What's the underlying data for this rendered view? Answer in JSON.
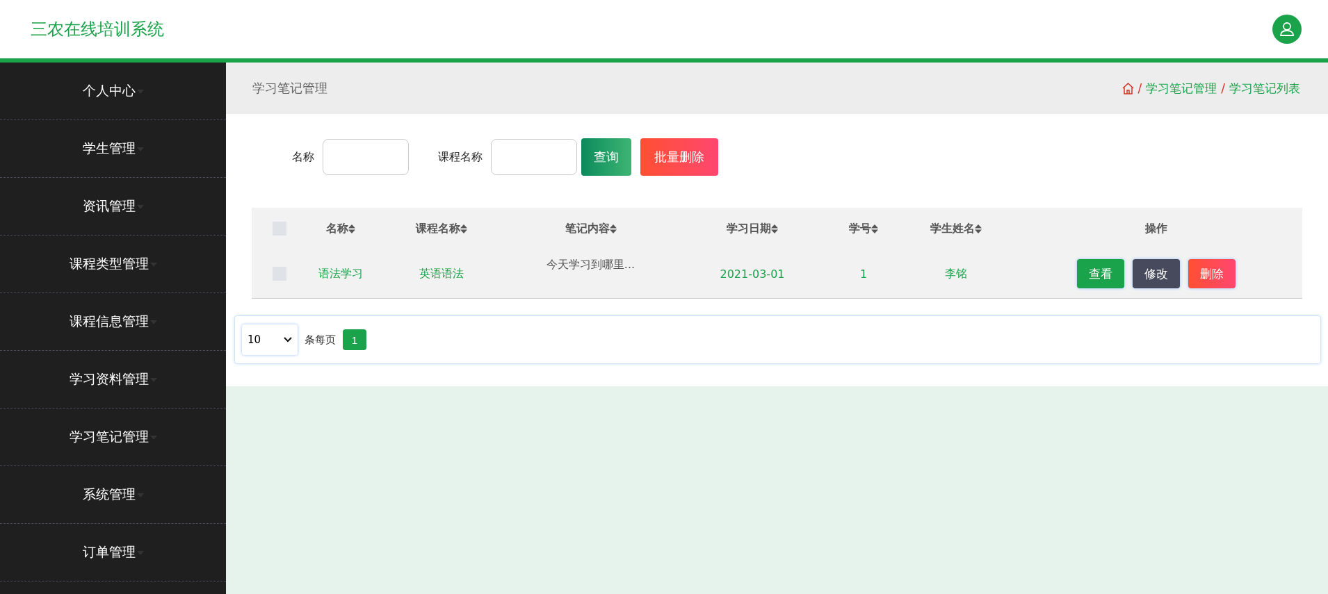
{
  "header": {
    "title": "三农在线培训系统"
  },
  "sidebar": {
    "items": [
      {
        "label": "个人中心"
      },
      {
        "label": "学生管理"
      },
      {
        "label": "资讯管理"
      },
      {
        "label": "课程类型管理"
      },
      {
        "label": "课程信息管理"
      },
      {
        "label": "学习资料管理"
      },
      {
        "label": "学习笔记管理"
      },
      {
        "label": "系统管理"
      },
      {
        "label": "订单管理"
      }
    ]
  },
  "page_title": "学习笔记管理",
  "breadcrumb": [
    {
      "separator": "/",
      "label": "学习笔记管理"
    },
    {
      "separator": "/",
      "label": "学习笔记列表"
    }
  ],
  "search": {
    "fields": [
      {
        "label": "名称"
      },
      {
        "label": "课程名称"
      }
    ],
    "query_button": "查询",
    "batch_delete_button": "批量删除"
  },
  "table": {
    "select_all_checked": false,
    "columns": [
      {
        "label": "名称",
        "sortable": true
      },
      {
        "label": "课程名称",
        "sortable": true
      },
      {
        "label": "笔记内容",
        "sortable": true
      },
      {
        "label": "学习日期",
        "sortable": true
      },
      {
        "label": "学号",
        "sortable": true
      },
      {
        "label": "学生姓名",
        "sortable": true
      },
      {
        "label": "操作",
        "sortable": false
      }
    ],
    "rows": [
      {
        "checked": false,
        "cells": [
          "语法学习",
          "英语语法",
          "今天学习到哪里...",
          "2021-03-01",
          "1",
          "李铭"
        ],
        "actions": [
          {
            "kind": "view",
            "label": "查看"
          },
          {
            "kind": "edit",
            "label": "修改"
          },
          {
            "kind": "delete",
            "label": "删除"
          }
        ]
      }
    ]
  },
  "pagination": {
    "page_size": "10",
    "page_size_label": "条每页",
    "pages": [
      {
        "label": "1",
        "selected": true
      }
    ]
  }
}
